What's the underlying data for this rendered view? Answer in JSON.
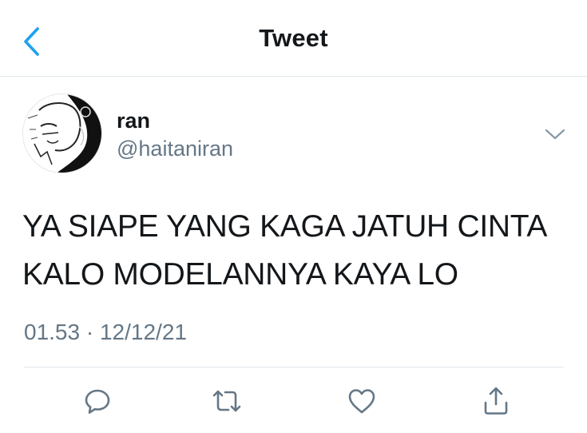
{
  "header": {
    "title": "Tweet",
    "back_icon": "chevron-left-icon"
  },
  "tweet": {
    "display_name": "ran",
    "handle": "@haitaniran",
    "text_lines": [
      "YA SIAPE YANG KAGA JATUH CINTA",
      "KALO MODELANNYA KAYA LO"
    ],
    "time": "01.53",
    "date": "12/12/21",
    "separator": "·"
  },
  "actions": [
    "reply-icon",
    "retweet-icon",
    "like-icon",
    "share-icon"
  ],
  "colors": {
    "accent": "#1da1f2",
    "text_primary": "#14171a",
    "text_secondary": "#657786",
    "divider": "#e1e8ed"
  }
}
